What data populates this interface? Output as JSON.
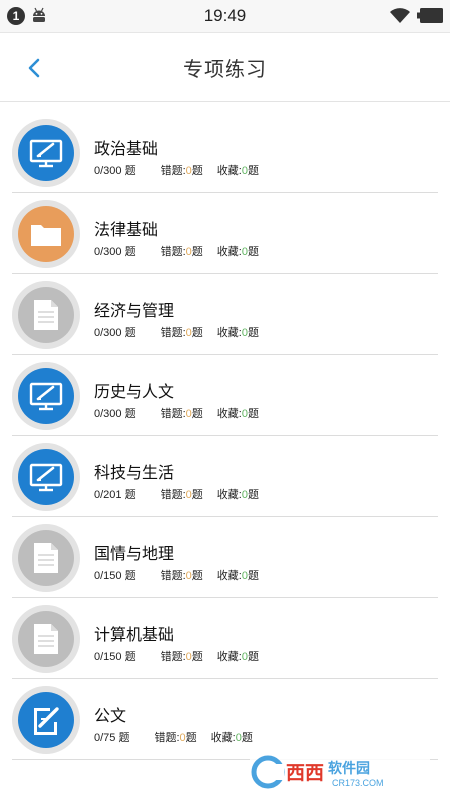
{
  "status_bar": {
    "notification_count": "1",
    "time": "19:49",
    "icons": [
      "notification-badge-icon",
      "android-icon",
      "wifi-icon",
      "battery-icon"
    ]
  },
  "header": {
    "back_icon": "chevron-left-icon",
    "title": "专项练习"
  },
  "colors": {
    "accent": "#2d8fd5",
    "icon_blue": "#1f7fd0",
    "icon_orange": "#e89d5b",
    "icon_gray": "#bdbdbd",
    "wrong_count": "#e0a95a",
    "fav_count": "#5fb35f"
  },
  "categories": [
    {
      "name": "政治基础",
      "icon": "monitor-pen-icon",
      "icon_color": "blue",
      "progress": "0/300 题",
      "wrong_label": "错题:",
      "wrong_count": "0",
      "wrong_unit": "题",
      "fav_label": "收藏:",
      "fav_count": "0",
      "fav_unit": "题"
    },
    {
      "name": "法律基础",
      "icon": "folder-icon",
      "icon_color": "orange",
      "progress": "0/300 题",
      "wrong_label": "错题:",
      "wrong_count": "0",
      "wrong_unit": "题",
      "fav_label": "收藏:",
      "fav_count": "0",
      "fav_unit": "题"
    },
    {
      "name": "经济与管理",
      "icon": "document-icon",
      "icon_color": "gray",
      "progress": "0/300 题",
      "wrong_label": "错题:",
      "wrong_count": "0",
      "wrong_unit": "题",
      "fav_label": "收藏:",
      "fav_count": "0",
      "fav_unit": "题"
    },
    {
      "name": "历史与人文",
      "icon": "monitor-pen-icon",
      "icon_color": "blue",
      "progress": "0/300 题",
      "wrong_label": "错题:",
      "wrong_count": "0",
      "wrong_unit": "题",
      "fav_label": "收藏:",
      "fav_count": "0",
      "fav_unit": "题"
    },
    {
      "name": "科技与生活",
      "icon": "monitor-pen-icon",
      "icon_color": "blue",
      "progress": "0/201 题",
      "wrong_label": "错题:",
      "wrong_count": "0",
      "wrong_unit": "题",
      "fav_label": "收藏:",
      "fav_count": "0",
      "fav_unit": "题"
    },
    {
      "name": "国情与地理",
      "icon": "document-icon",
      "icon_color": "gray",
      "progress": "0/150 题",
      "wrong_label": "错题:",
      "wrong_count": "0",
      "wrong_unit": "题",
      "fav_label": "收藏:",
      "fav_count": "0",
      "fav_unit": "题"
    },
    {
      "name": "计算机基础",
      "icon": "document-icon",
      "icon_color": "gray",
      "progress": "0/150 题",
      "wrong_label": "错题:",
      "wrong_count": "0",
      "wrong_unit": "题",
      "fav_label": "收藏:",
      "fav_count": "0",
      "fav_unit": "题"
    },
    {
      "name": "公文",
      "icon": "edit-note-icon",
      "icon_color": "blue",
      "progress": "0/75 题",
      "wrong_label": "错题:",
      "wrong_count": "0",
      "wrong_unit": "题",
      "fav_label": "收藏:",
      "fav_count": "0",
      "fav_unit": "题"
    }
  ],
  "watermark": {
    "brand": "西西",
    "brand_suffix": "软件园",
    "site": "CR173.COM"
  }
}
